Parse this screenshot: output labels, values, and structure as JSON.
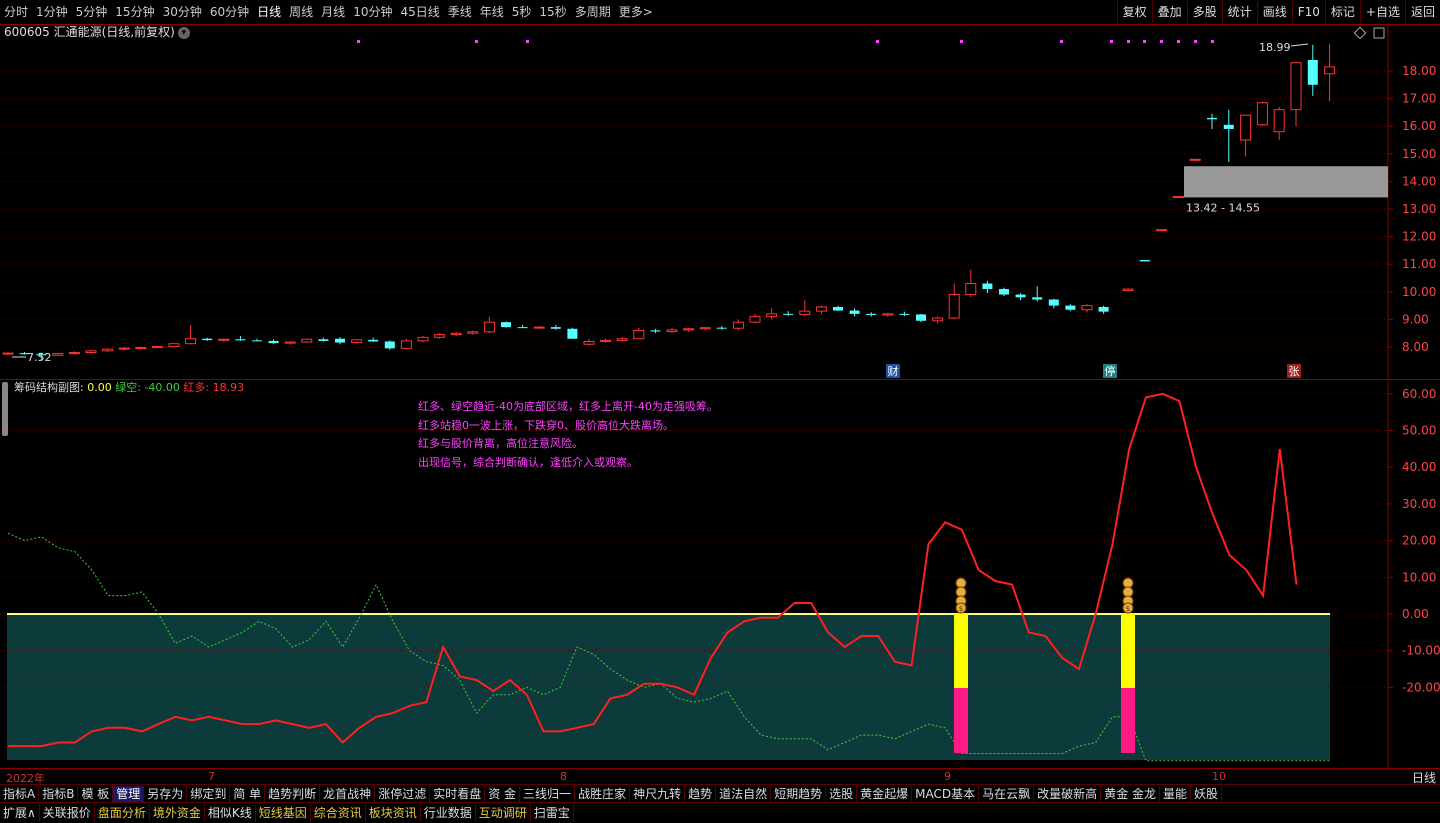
{
  "topbar": {
    "periods": [
      "分时",
      "1分钟",
      "5分钟",
      "15分钟",
      "30分钟",
      "60分钟",
      "日线",
      "周线",
      "月线",
      "10分钟",
      "45日线",
      "季线",
      "年线",
      "5秒",
      "15秒",
      "多周期",
      "更多>"
    ],
    "active_period": "日线",
    "right_buttons": [
      "复权",
      "叠加",
      "多股",
      "统计",
      "画线",
      "F10",
      "标记",
      "+自选",
      "返回"
    ]
  },
  "stock": {
    "title": "600605 汇通能源(日线,前复权)",
    "low_label": "7.52",
    "high_label": "18.99",
    "zone_label": "13.42 - 14.55",
    "event_labels": [
      "财",
      "停",
      "张"
    ]
  },
  "price_axis": [
    "18.00",
    "17.00",
    "16.00",
    "15.00",
    "14.00",
    "13.00",
    "12.00",
    "11.00",
    "10.00",
    "9.00",
    "8.00"
  ],
  "indicator": {
    "name": "筹码结构副图",
    "value0": ": 0.00",
    "green_label": "绿空: -40.00",
    "red_label": "红多: 18.93",
    "notes": [
      "红多、绿空趋近-40为底部区域，红多上离开-40为走强吸筹。",
      "红多站稳0一波上涨，下跌穿0、股价高位大跌离场。",
      "红多与股价背离，高位注意风险。",
      "出现信号，综合判断确认，逢低介入或观察。"
    ],
    "axis": [
      "60.00",
      "50.00",
      "40.00",
      "30.00",
      "20.00",
      "10.00",
      "0.00",
      "-10.00",
      "-20.00"
    ]
  },
  "dates": [
    "2022年",
    "7",
    "8",
    "9",
    "10"
  ],
  "period_right": "日线",
  "indicator_buttons": [
    "指标A",
    "指标B",
    "模 板",
    "管理",
    "另存为",
    "绑定到",
    "简 单",
    "趋势判断",
    "龙首战神",
    "涨停过滤",
    "实时看盘",
    "资 金",
    "三线归一",
    "战胜庄家",
    "神尺九转",
    "趋势",
    "道法自然",
    "短期趋势",
    "选股",
    "黄金起爆",
    "MACD基本",
    "马在云飘",
    "改量破新高",
    "黄金 金龙",
    "量能",
    "妖股"
  ],
  "active_indicator_button": "管理",
  "ext_buttons": [
    "扩展∧",
    "关联报价",
    "盘面分析",
    "境外资金",
    "相似K线",
    "短线基因",
    "综合资讯",
    "板块资讯",
    "行业数据",
    "互动调研",
    "扫雷宝"
  ],
  "colors": {
    "up": "#ff3333",
    "down": "#54ffff",
    "green_line": "#3ccf3c",
    "red_line": "#ff2020",
    "fill": "#0d3a3a",
    "zero": "#ffff80"
  }
}
